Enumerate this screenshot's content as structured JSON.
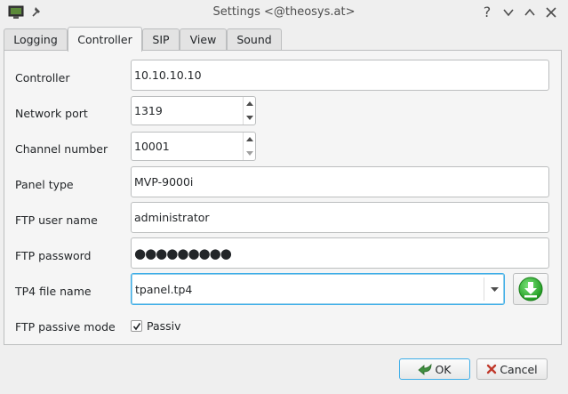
{
  "window": {
    "title": "Settings <@theosys.at>",
    "help_glyph": "?",
    "icons": [
      "app-icon",
      "pin-icon",
      "help-icon",
      "minimize-icon",
      "maximize-icon",
      "close-icon"
    ]
  },
  "tabs": [
    {
      "label": "Logging",
      "active": false
    },
    {
      "label": "Controller",
      "active": true
    },
    {
      "label": "SIP",
      "active": false
    },
    {
      "label": "View",
      "active": false
    },
    {
      "label": "Sound",
      "active": false
    }
  ],
  "form": {
    "controller": {
      "label": "Controller",
      "value": "10.10.10.10"
    },
    "network_port": {
      "label": "Network port",
      "value": "1319"
    },
    "channel_number": {
      "label": "Channel number",
      "value": "10001"
    },
    "panel_type": {
      "label": "Panel type",
      "value": "MVP-9000i"
    },
    "ftp_user": {
      "label": "FTP user name",
      "value": "administrator"
    },
    "ftp_password": {
      "label": "FTP password",
      "masked": "●●●●●●●●●"
    },
    "tp4_file": {
      "label": "TP4 file name",
      "value": "tpanel.tp4",
      "download_icon": "download-arrow-icon"
    },
    "ftp_passive": {
      "label": "FTP passive mode",
      "checkbox_label": "Passiv",
      "checked": true
    }
  },
  "buttons": {
    "ok": "OK",
    "cancel": "Cancel"
  },
  "colors": {
    "accent": "#3daee9",
    "download_green": "#2fb52f",
    "cancel_red": "#c0392b"
  }
}
